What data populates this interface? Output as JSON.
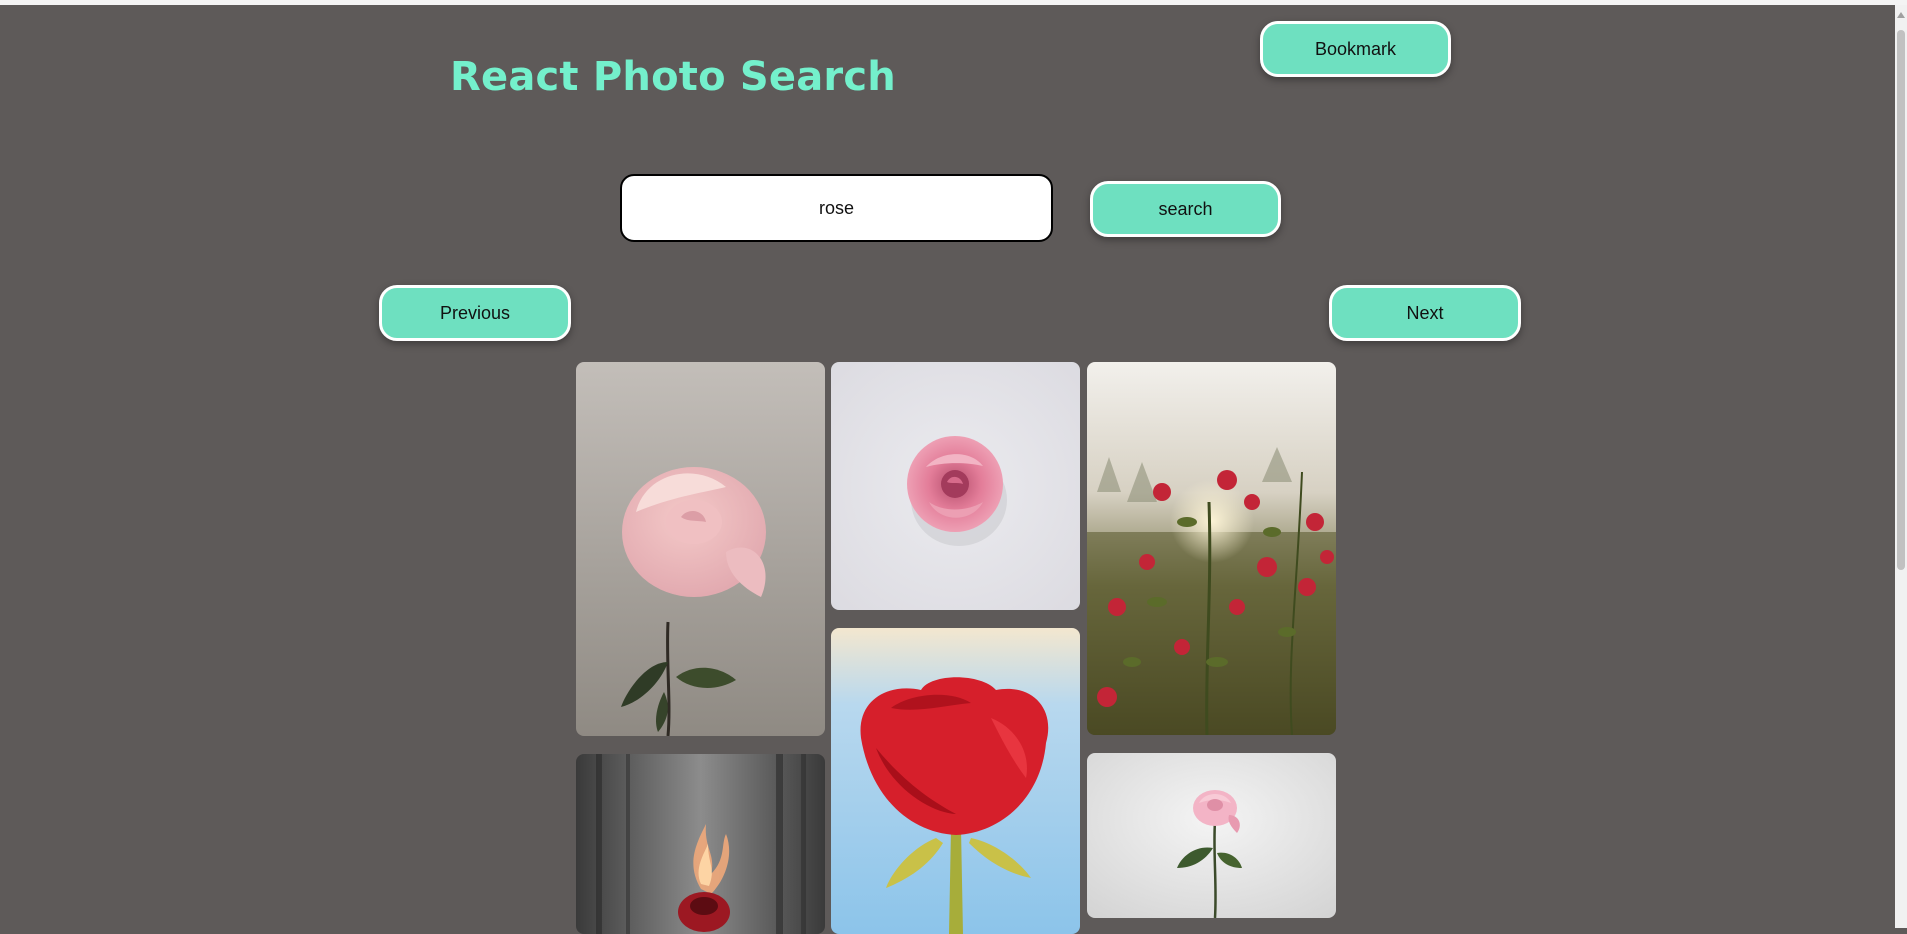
{
  "header": {
    "title": "React Photo Search",
    "bookmark_label": "Bookmark"
  },
  "search": {
    "value": "rose",
    "button_label": "search"
  },
  "pagination": {
    "previous_label": "Previous",
    "next_label": "Next"
  },
  "gallery": {
    "photos": [
      {
        "subject": "pale pink rose on long stem, grey background"
      },
      {
        "subject": "pink rose head from above, white background"
      },
      {
        "subject": "red rose bushes in sunlight"
      },
      {
        "subject": "burning red rose, dark forest background"
      },
      {
        "subject": "red rose against blue sky"
      },
      {
        "subject": "small pink rose on white background"
      }
    ]
  },
  "colors": {
    "accent": "#74f0cc",
    "button": "#6ee0c0",
    "background": "#5e5a59"
  }
}
